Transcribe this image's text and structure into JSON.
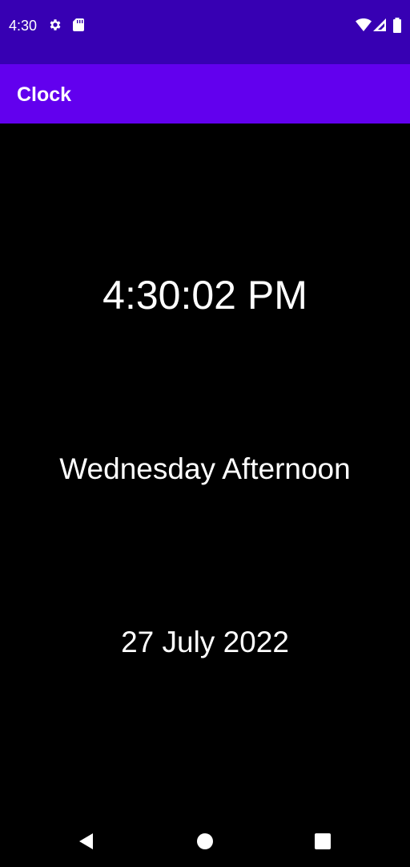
{
  "status_bar": {
    "time": "4:30",
    "background": "#3700b3",
    "icons": [
      "settings-gear-icon",
      "sd-card-icon",
      "wifi-icon",
      "signal-icon",
      "battery-icon"
    ]
  },
  "app_bar": {
    "title": "Clock",
    "background": "#6200ee"
  },
  "clock": {
    "time": "4:30:02 PM",
    "day_part": "Wednesday Afternoon",
    "date": "27 July 2022",
    "text_color": "#ffffff",
    "background": "#000000"
  },
  "nav_bar": {
    "buttons": [
      "back-icon",
      "home-icon",
      "recents-icon"
    ]
  }
}
